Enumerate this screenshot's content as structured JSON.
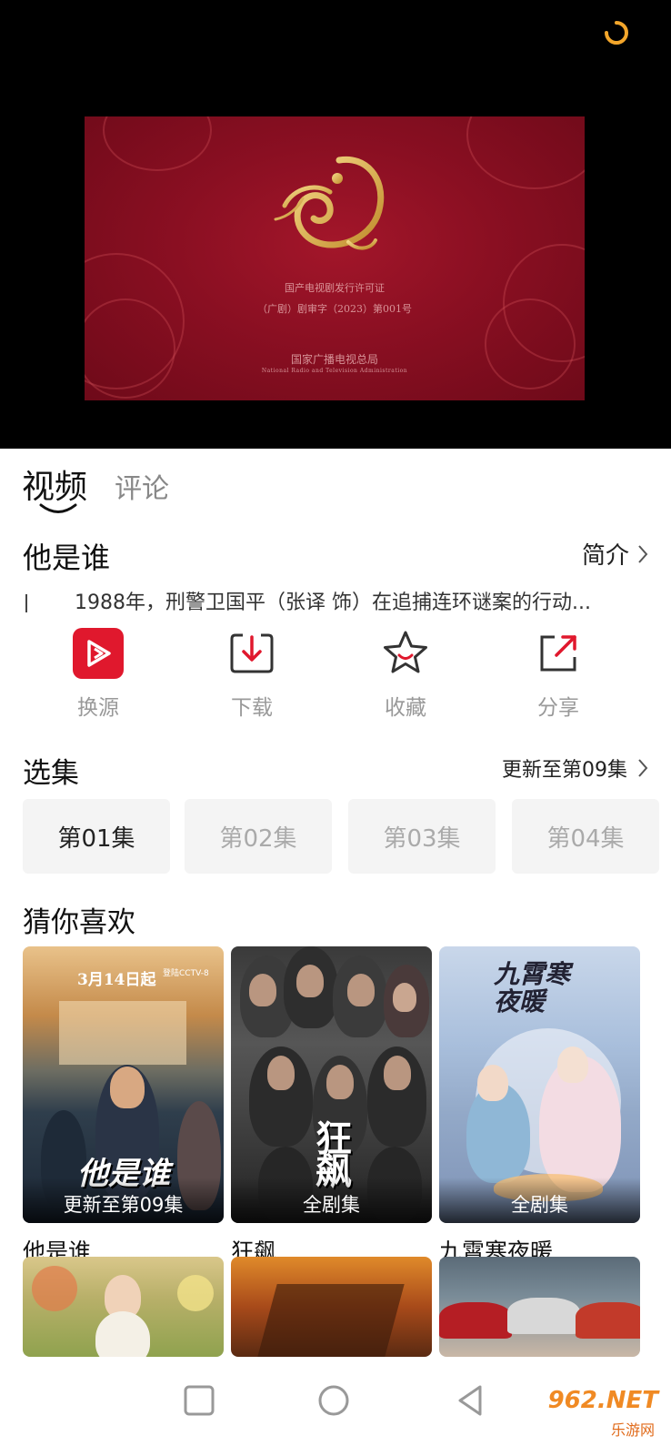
{
  "player": {
    "cert_line1": "国产电视剧发行许可证",
    "cert_line2": "（广剧）剧审字（2023）第001号",
    "cert_org": "国家广播电视总局",
    "cert_org_en": "National Radio and Television Administration"
  },
  "tabs": [
    {
      "label": "视频",
      "active": true
    },
    {
      "label": "评论",
      "active": false
    }
  ],
  "show": {
    "title": "他是谁",
    "intro_label": "简介",
    "description": "1988年，刑警卫国平（张译 饰）在追捕连环谜案的行动..."
  },
  "actions": [
    {
      "label": "换源",
      "icon": "source-switch-icon"
    },
    {
      "label": "下载",
      "icon": "download-icon"
    },
    {
      "label": "收藏",
      "icon": "star-icon"
    },
    {
      "label": "分享",
      "icon": "share-icon"
    }
  ],
  "episodes_section": {
    "title": "选集",
    "update_text": "更新至第09集",
    "episodes": [
      "第01集",
      "第02集",
      "第03集",
      "第04集"
    ]
  },
  "recommend_section": {
    "title": "猜你喜欢",
    "items": [
      {
        "name": "他是谁",
        "badge": "更新至第09集",
        "poster_text": "他是谁",
        "poster_date": "3月14日起",
        "poster_channel": "登陆CCTV-8"
      },
      {
        "name": "狂飙",
        "badge": "全剧集",
        "poster_text": "狂飙"
      },
      {
        "name": "九霄寒夜暖",
        "badge": "全剧集",
        "poster_text": "九霄寒夜暖"
      },
      {
        "name": "",
        "badge": ""
      },
      {
        "name": "",
        "badge": ""
      },
      {
        "name": "",
        "badge": ""
      }
    ]
  },
  "watermark": {
    "brand": "962.NET",
    "sub": "乐游网"
  },
  "colors": {
    "accent": "#e0182d",
    "loading": "#f3a62b",
    "muted": "#999999"
  }
}
